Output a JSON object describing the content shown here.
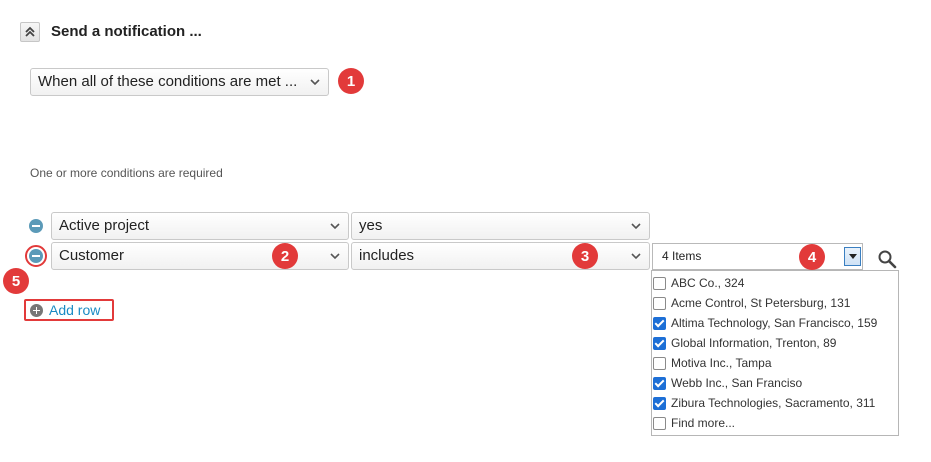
{
  "section": {
    "title": "Send a notification ..."
  },
  "match_select": {
    "value": "When all of these conditions are met ..."
  },
  "hint": "One or more conditions are required",
  "rows": [
    {
      "field": "Active project",
      "operator": "yes"
    },
    {
      "field": "Customer",
      "operator": "includes",
      "value": "4 Items"
    }
  ],
  "add_row_label": "Add row",
  "options": [
    {
      "label": "ABC Co., 324",
      "checked": false
    },
    {
      "label": "Acme Control, St Petersburg, 131",
      "checked": false
    },
    {
      "label": "Altima Technology, San Francisco, 159",
      "checked": true
    },
    {
      "label": "Global Information, Trenton, 89",
      "checked": true
    },
    {
      "label": "Motiva Inc., Tampa",
      "checked": false
    },
    {
      "label": "Webb Inc., San Franciso",
      "checked": true
    },
    {
      "label": "Zibura Technologies, Sacramento, 311",
      "checked": true
    },
    {
      "label": "Find more...",
      "checked": false
    }
  ],
  "badges": [
    "1",
    "2",
    "3",
    "4",
    "5"
  ],
  "colors": {
    "badge": "#e23a3a",
    "link": "#1a8bc4",
    "row_icon": "#5b9ab8",
    "checkbox_on": "#1d6fd6"
  }
}
